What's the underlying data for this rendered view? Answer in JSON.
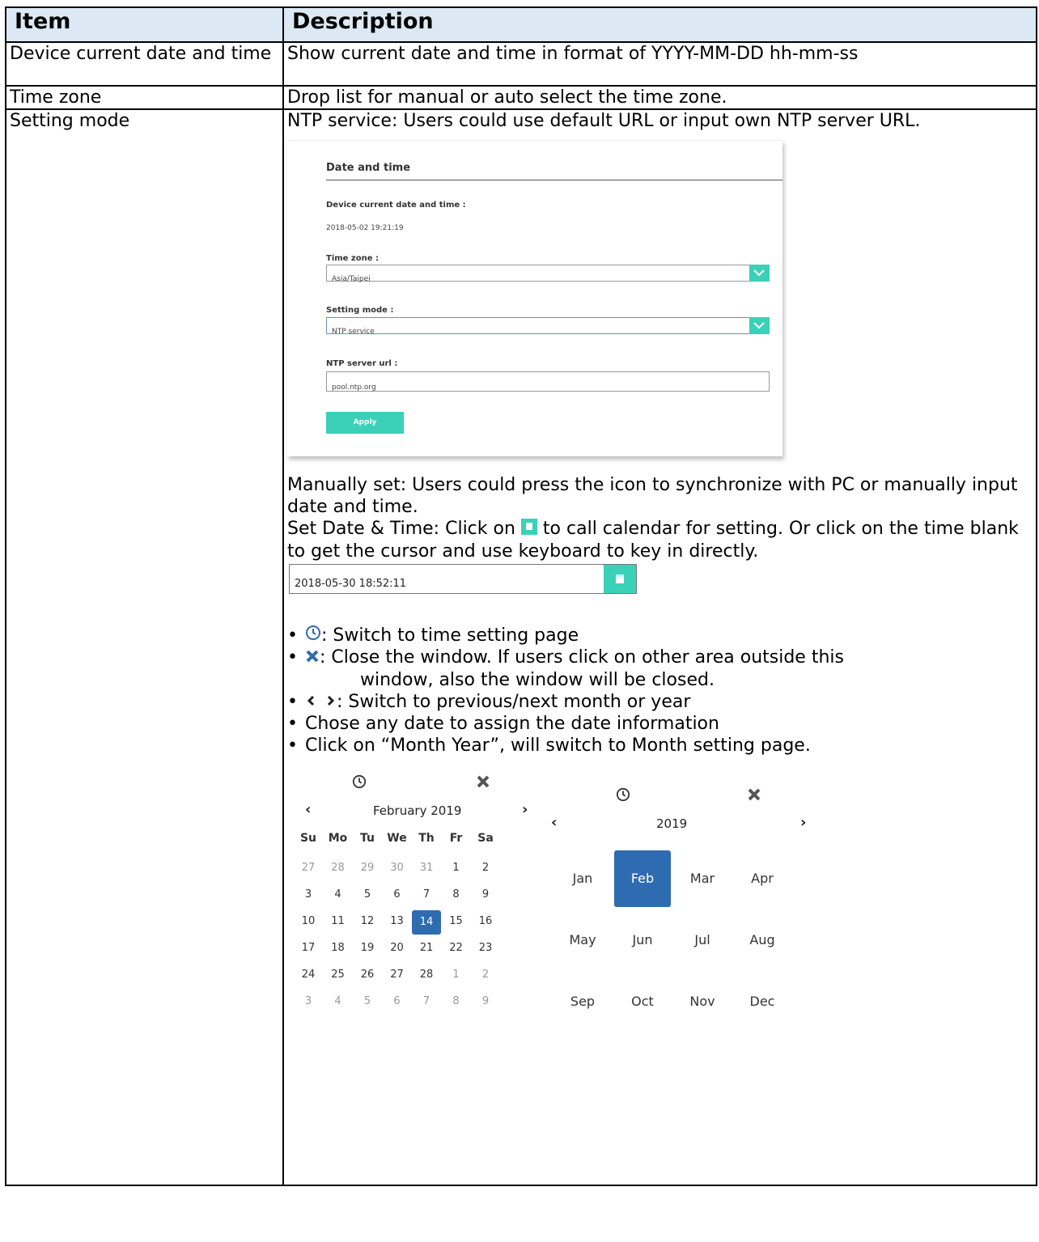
{
  "header": {
    "col_item": "Item",
    "col_desc": "Description"
  },
  "rows": [
    {
      "item": "Device current date and time",
      "desc": "Show current date and time in format of YYYY-MM-DD hh-mm-ss"
    },
    {
      "item": "Time zone",
      "desc": "Drop list for manual or auto select the time zone."
    },
    {
      "item": "Setting mode",
      "desc": "NTP service: Users could use default URL or input own NTP server URL."
    }
  ],
  "ntp_screen": {
    "title": "Date and time",
    "current_label": "Device current date and time :",
    "current_value": "2018-05-02 19:21:19",
    "tz_label": "Time zone :",
    "tz_value": "Asia/Taipei",
    "mode_label": "Setting mode :",
    "mode_value": "NTP service",
    "ntp_label": "NTP server url :",
    "ntp_value": "pool.ntp.org",
    "apply": "Apply"
  },
  "manual": {
    "p1": "Manually set: Users could press the icon to synchronize with PC or manually input date and time.",
    "p2a": "Set Date & Time: Click on",
    "p2b": "to call calendar for setting. Or click on the time blank to get the cursor and use keyboard to key in directly.",
    "input_value": "2018-05-30 18:52:11"
  },
  "bullets": {
    "b1": ": Switch to time setting page",
    "b2a": ": Close the window. If users click on other area outside this",
    "b2b": "window, also the window will be closed.",
    "b3": ": Switch to previous/next month or year",
    "b4": "Chose any date to assign the date information",
    "b5": "Click on “Month Year”, will switch to Month setting page."
  },
  "day_calendar": {
    "title": "February 2019",
    "prev": "‹",
    "next": "›",
    "dow": [
      "Su",
      "Mo",
      "Tu",
      "We",
      "Th",
      "Fr",
      "Sa"
    ],
    "weeks": [
      [
        "27",
        "28",
        "29",
        "30",
        "31",
        "1",
        "2"
      ],
      [
        "3",
        "4",
        "5",
        "6",
        "7",
        "8",
        "9"
      ],
      [
        "10",
        "11",
        "12",
        "13",
        "14",
        "15",
        "16"
      ],
      [
        "17",
        "18",
        "19",
        "20",
        "21",
        "22",
        "23"
      ],
      [
        "24",
        "25",
        "26",
        "27",
        "28",
        "1",
        "2"
      ],
      [
        "3",
        "4",
        "5",
        "6",
        "7",
        "8",
        "9"
      ]
    ],
    "selected": "14"
  },
  "month_calendar": {
    "title": "2019",
    "months": [
      [
        "Jan",
        "Feb",
        "Mar",
        "Apr"
      ],
      [
        "May",
        "Jun",
        "Jul",
        "Aug"
      ],
      [
        "Sep",
        "Oct",
        "Nov",
        "Dec"
      ]
    ],
    "selected": "Feb"
  },
  "colors": {
    "accent": "#3ad1b8",
    "selected": "#2f6bb0",
    "header_bg": "#dce9f5"
  }
}
